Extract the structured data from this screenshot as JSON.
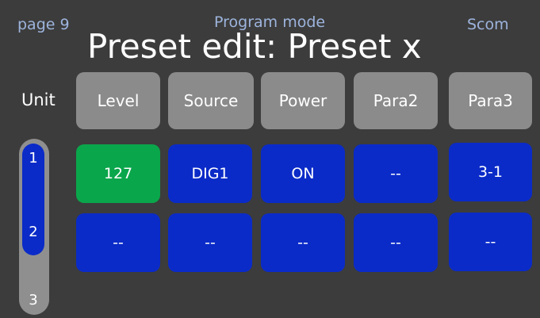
{
  "header": {
    "page_label": "page 9",
    "mode_label": "Program mode",
    "scom_label": "Scom",
    "title": "Preset edit: Preset x"
  },
  "unit": {
    "label": "Unit",
    "numbers": [
      "1",
      "2",
      "3"
    ],
    "selected_range": [
      "1",
      "2"
    ]
  },
  "columns": [
    "Level",
    "Source",
    "Power",
    "Para2",
    "Para3"
  ],
  "rows": [
    [
      "127",
      "DIG1",
      "ON",
      "--",
      "3-1"
    ],
    [
      "--",
      "--",
      "--",
      "--",
      "--"
    ]
  ],
  "colors": {
    "background": "#3c3c3c",
    "button_gray": "#8b8b8b",
    "cell_blue": "#0a2bc8",
    "cell_active_green": "#0aa64b",
    "label_blue": "#9db4dd"
  }
}
